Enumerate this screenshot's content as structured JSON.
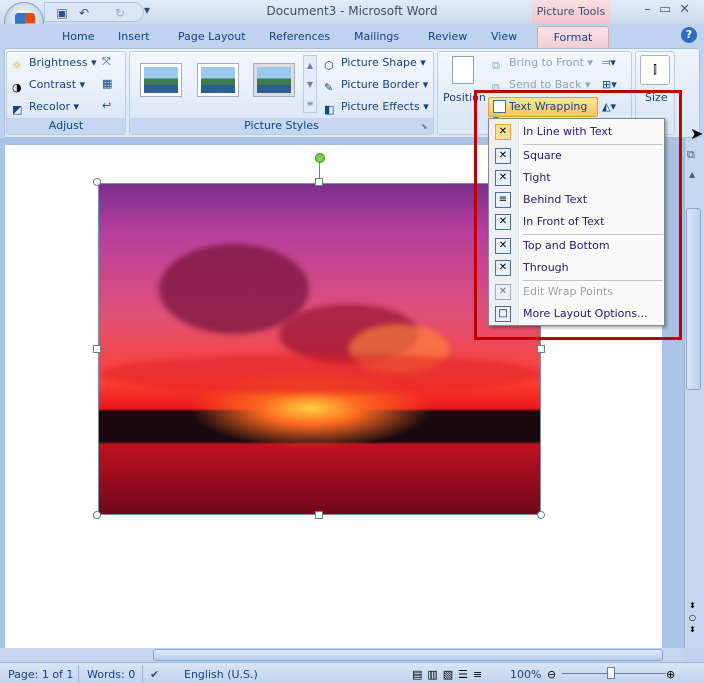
{
  "window": {
    "title": "Document3 - Microsoft Word",
    "contextual_tab": "Picture Tools"
  },
  "tabs": [
    "Home",
    "Insert",
    "Page Layout",
    "References",
    "Mailings",
    "Review",
    "View",
    "Format"
  ],
  "ribbon": {
    "adjust": {
      "label": "Adjust",
      "brightness": "Brightness",
      "contrast": "Contrast",
      "recolor": "Recolor"
    },
    "picture_styles": {
      "label": "Picture Styles",
      "shape": "Picture Shape",
      "border": "Picture Border",
      "effects": "Picture Effects"
    },
    "arrange": {
      "position": "Position",
      "bring_front": "Bring to Front",
      "send_back": "Send to Back",
      "text_wrapping": "Text Wrapping"
    },
    "size": {
      "label": "Size"
    }
  },
  "text_wrapping_menu": [
    {
      "label": "In Line with Text",
      "state": "selected"
    },
    {
      "label": "Square",
      "state": "normal"
    },
    {
      "label": "Tight",
      "state": "normal"
    },
    {
      "label": "Behind Text",
      "state": "normal"
    },
    {
      "label": "In Front of Text",
      "state": "normal"
    },
    {
      "label": "Top and Bottom",
      "state": "normal"
    },
    {
      "label": "Through",
      "state": "normal"
    },
    {
      "label": "Edit Wrap Points",
      "state": "disabled"
    },
    {
      "label": "More Layout Options...",
      "state": "normal"
    }
  ],
  "status": {
    "page": "Page: 1 of 1",
    "words": "Words: 0",
    "language": "English (U.S.)",
    "zoom": "100%"
  },
  "colors": {
    "highlight": "#c00000",
    "accent": "#15428b"
  }
}
